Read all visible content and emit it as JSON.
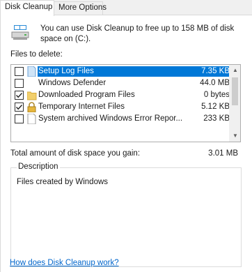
{
  "tabs": [
    {
      "label": "Disk Cleanup",
      "active": true
    },
    {
      "label": "More Options",
      "active": false
    }
  ],
  "intro": {
    "line1": "You can use Disk Cleanup to free up to 158 MB of disk",
    "line2": "space on  (C:)."
  },
  "files_label": "Files to delete:",
  "files": [
    {
      "name": "Setup Log Files",
      "size": "7.35 KB",
      "checked": false,
      "selected": true,
      "icon": "document-icon"
    },
    {
      "name": "Windows Defender",
      "size": "44.0 MB",
      "checked": false,
      "selected": false,
      "icon": "blank-icon"
    },
    {
      "name": "Downloaded Program Files",
      "size": "0 bytes",
      "checked": true,
      "selected": false,
      "icon": "folder-icon"
    },
    {
      "name": "Temporary Internet Files",
      "size": "5.12 KB",
      "checked": true,
      "selected": false,
      "icon": "lock-icon"
    },
    {
      "name": "System archived Windows Error Repor...",
      "size": "233 KB",
      "checked": false,
      "selected": false,
      "icon": "document-icon"
    }
  ],
  "total": {
    "label": "Total amount of disk space you gain:",
    "value": "3.01 MB"
  },
  "description": {
    "legend": "Description",
    "text": "Files created by Windows"
  },
  "help_link": "How does Disk Cleanup work?",
  "colors": {
    "selection": "#0078d7",
    "link": "#0066cc"
  }
}
